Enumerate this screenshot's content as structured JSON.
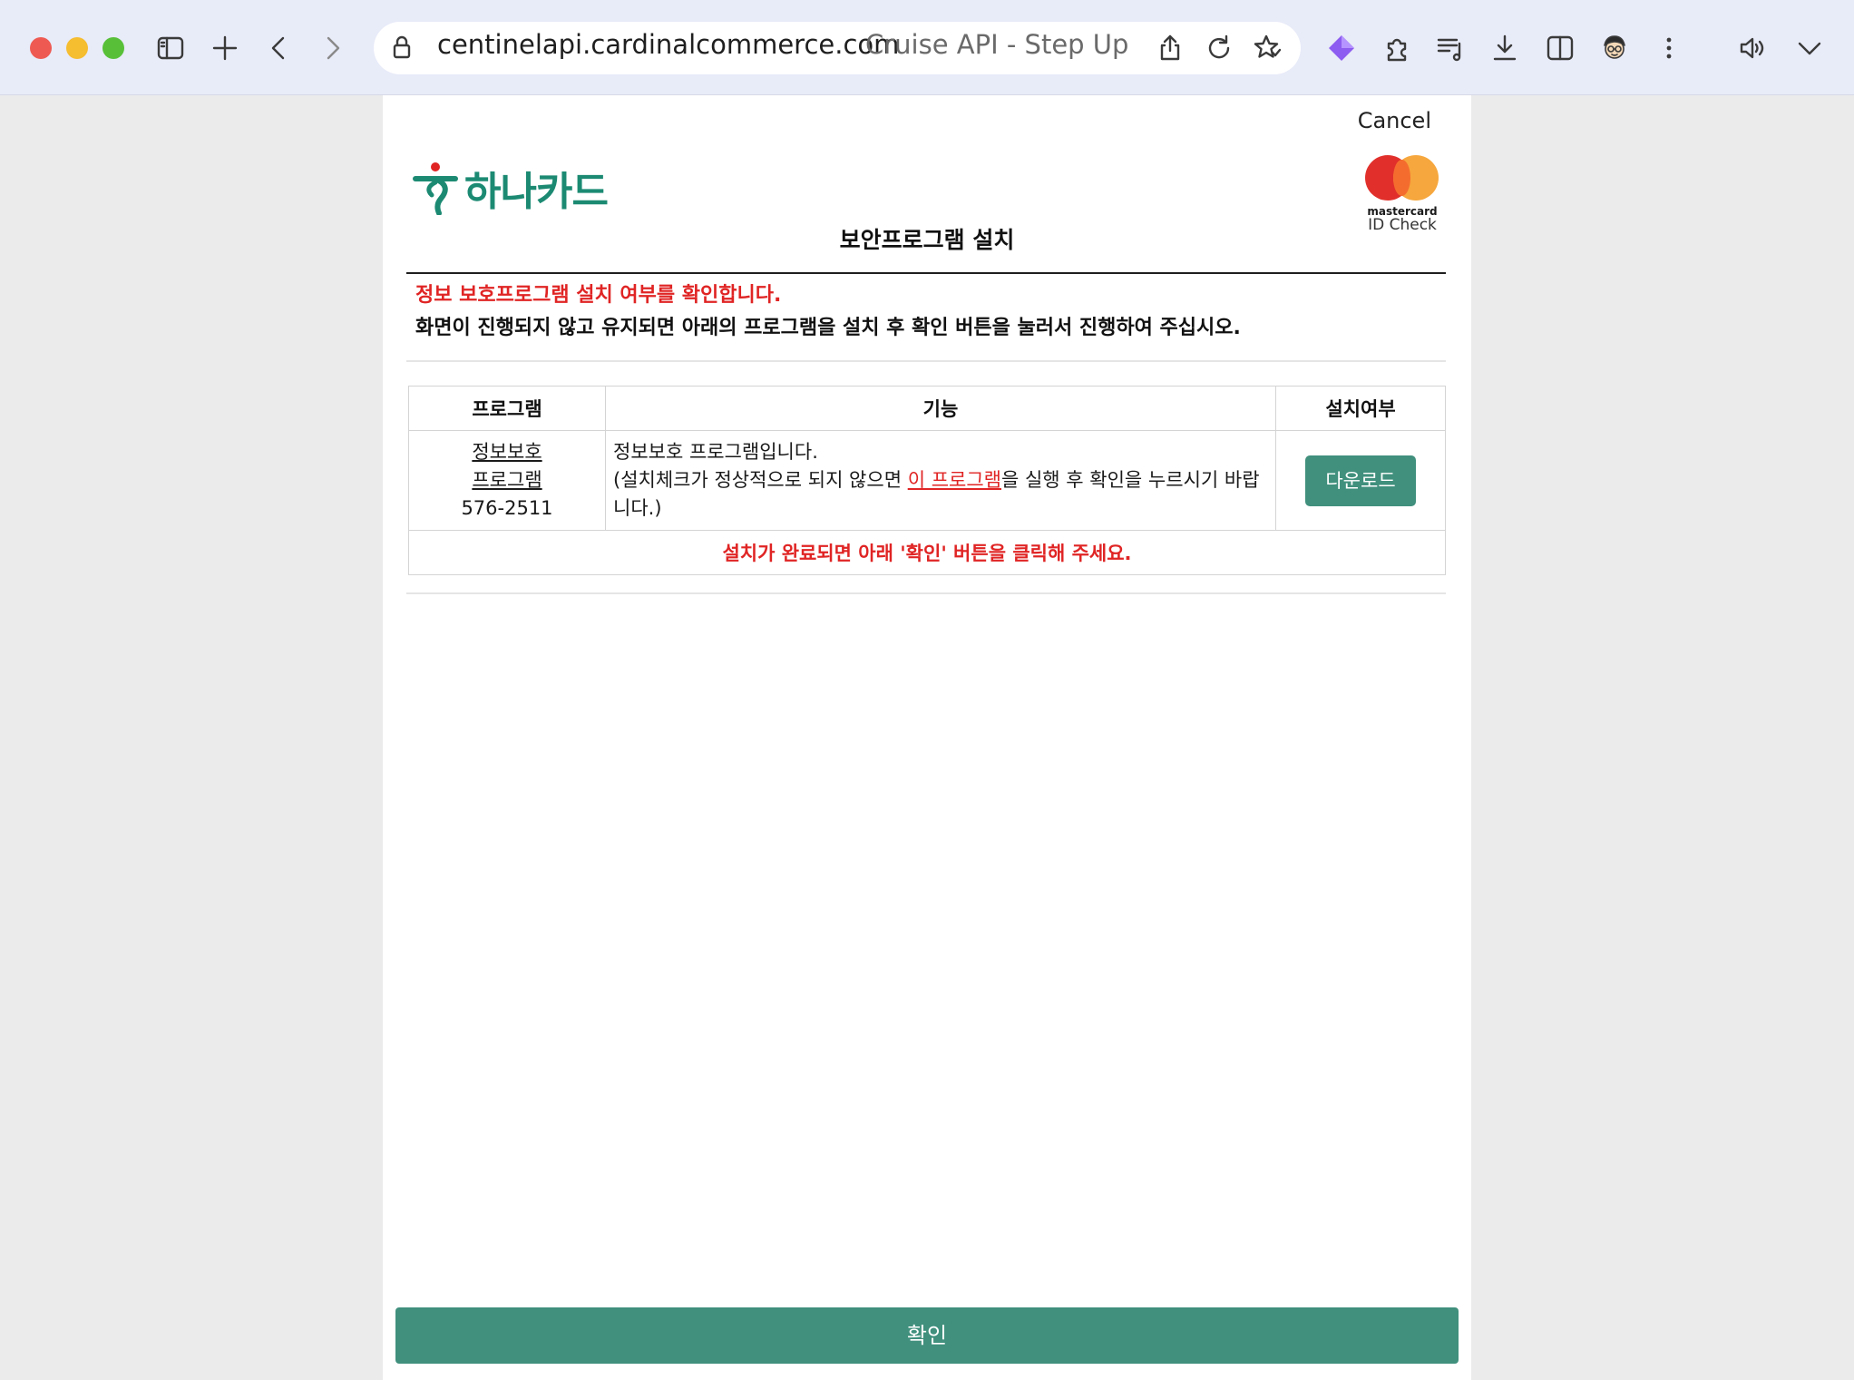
{
  "browser": {
    "url_host": "centinelapi.cardinalcommerce.com",
    "tab_title": "Cruise API - Step Up",
    "icons": [
      "sidebar-icon",
      "plus-icon",
      "back-icon",
      "forward-icon",
      "lock-icon",
      "share-icon",
      "reload-icon",
      "favorite-icon",
      "extension-gem-icon",
      "extensions-icon",
      "reading-list-icon",
      "download-icon",
      "split-view-icon",
      "profile-avatar",
      "more-icon",
      "speaker-icon",
      "chevron-down-icon"
    ]
  },
  "header": {
    "cancel_label": "Cancel",
    "bank_name": "하나카드",
    "mastercard_brand": "mastercard",
    "mastercard_sub": "ID Check",
    "page_title": "보안프로그램 설치"
  },
  "notice": {
    "red_line": "정보 보호프로그램 설치 여부를 확인합니다.",
    "black_line": "화면이 진행되지 않고 유지되면 아래의 프로그램을 설치 후 확인 버튼을 눌러서 진행하여 주십시오."
  },
  "table": {
    "headers": [
      "프로그램",
      "기능",
      "설치여부"
    ],
    "row": {
      "name_line1": "정보보호",
      "name_line2": "프로그램",
      "name_line3": "576-2511",
      "func_line1": "정보보호 프로그램입니다.",
      "func_line2_pre": "(설치체크가 정상적으로 되지 않으면 ",
      "func_line2_link": "이 프로그램",
      "func_line2_post": "을 실행 후 확인을 누르시기 바랍니다.)",
      "download_label": "다운로드"
    },
    "footer_note": "설치가 완료되면 아래 '확인' 버튼을 클릭해 주세요."
  },
  "confirm_label": "확인",
  "colors": {
    "accent_green": "#40907d",
    "alert_red": "#e02424"
  }
}
